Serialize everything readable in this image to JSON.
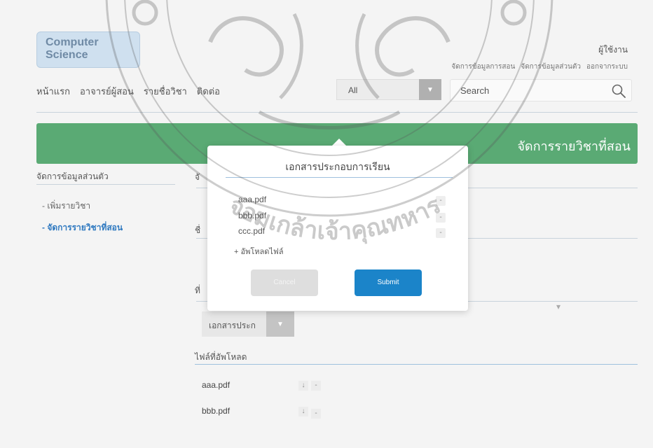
{
  "logo": {
    "text": "Computer Science"
  },
  "header": {
    "user_label": "ผู้ใช้งาน",
    "links": [
      "จัดการข้อมูลการสอน",
      "จัดการข้อมูลส่วนตัว",
      "ออกจากระบบ"
    ]
  },
  "nav": {
    "items": [
      "หน้าแรก",
      "อาจารย์ผู้สอน",
      "รายชื่อวิชา",
      "ติดต่อ"
    ]
  },
  "filter": {
    "selected": "All"
  },
  "search": {
    "placeholder": "Search"
  },
  "banner": {
    "title": "จัดการรายวิชาที่สอน"
  },
  "sidebar": {
    "heading": "จัดการข้อมูลส่วนตัว",
    "items": [
      "- เพิ่มรายวิชา",
      "- จัดการรายวิชาที่สอน"
    ]
  },
  "main": {
    "frag1": "จั",
    "frag2": "ชื่",
    "frag3": "ที่",
    "doc_select": "เอกสารประก",
    "uploaded_heading": "ไฟล์ที่อัพโหลด",
    "files": [
      "aaa.pdf",
      "bbb.pdf"
    ],
    "download_glyph": "↓",
    "remove_glyph": "-"
  },
  "modal": {
    "title": "เอกสารประกอบการเรียน",
    "files": [
      "aaa.pdf",
      "bbb.pdf",
      "ccc.pdf"
    ],
    "remove_glyph": "-",
    "upload_label": "+ อัพโหลดไฟล์",
    "cancel_label": "Cancel",
    "submit_label": "Submit"
  },
  "watermark": {
    "text": "จอมเกล้าเจ้าคุณทหาร"
  },
  "colors": {
    "banner": "#5aaa74",
    "submit": "#1b84c9",
    "link_active": "#2f79c0"
  }
}
